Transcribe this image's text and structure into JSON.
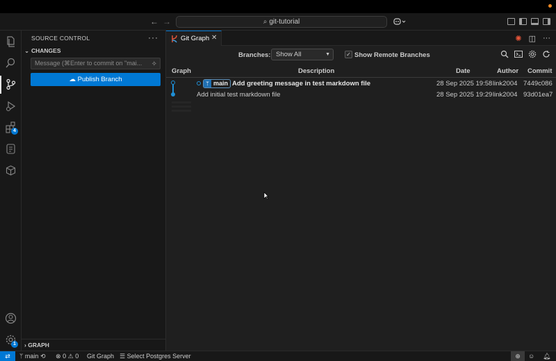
{
  "titlebar": {
    "search_text": "git-tutorial",
    "back_icon": "arrow-left-icon",
    "forward_icon": "arrow-right-icon"
  },
  "activity": {
    "extensions_badge": "4",
    "accounts_badge": "1"
  },
  "sidebar": {
    "title": "SOURCE CONTROL",
    "section": "CHANGES",
    "commit_placeholder": "Message (⌘Enter to commit on \"mai...",
    "publish_label": "Publish Branch",
    "graph_section": "GRAPH"
  },
  "editor": {
    "tab_label": "Git Graph"
  },
  "controls": {
    "branches_label": "Branches:",
    "branches_value": "Show All",
    "remote_label": "Show Remote Branches",
    "remote_checked": true
  },
  "table": {
    "headers": {
      "graph": "Graph",
      "description": "Description",
      "date": "Date",
      "author": "Author",
      "commit": "Commit"
    },
    "rows": [
      {
        "ref": "main",
        "description": "Add greeting message in test markdown file",
        "date": "28 Sep 2025 19:58",
        "author": "link2004",
        "commit": "7449c086"
      },
      {
        "ref": "",
        "description": "Add initial test markdown file",
        "date": "28 Sep 2025 19:29",
        "author": "link2004",
        "commit": "93d01ea7"
      }
    ]
  },
  "status": {
    "branch": "main",
    "errors": "0",
    "warnings": "0",
    "git_graph": "Git Graph",
    "postgres": "Select Postgres Server"
  },
  "colors": {
    "accent": "#0078d4",
    "graph_line": "#1f8fd6",
    "ref_badge": "#1f6fb2"
  }
}
